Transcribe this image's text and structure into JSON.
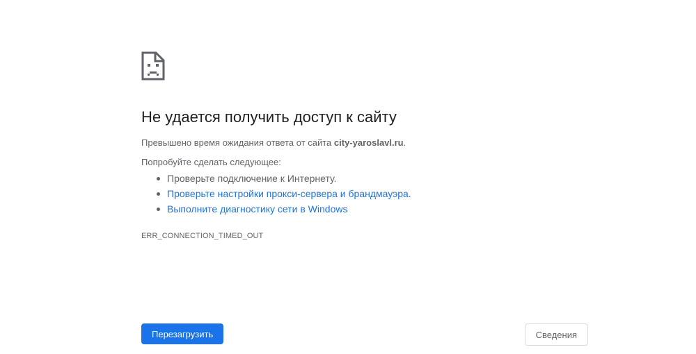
{
  "error": {
    "icon": "sad-page-icon",
    "title": "Не удается получить доступ к сайту",
    "summary_prefix": "Превышено время ожидания ответа от сайта ",
    "site": "city-yaroslavl.ru",
    "summary_suffix": ".",
    "suggestions_heading": "Попробуйте сделать следующее:",
    "suggestions": [
      {
        "text": "Проверьте подключение к Интернету."
      },
      {
        "text": "Проверьте настройки прокси-сервера и брандмауэра."
      },
      {
        "text": "Выполните диагностику сети в Windows"
      }
    ],
    "code": "ERR_CONNECTION_TIMED_OUT"
  },
  "buttons": {
    "reload_label": "Перезагрузить",
    "details_label": "Сведения"
  },
  "colors": {
    "accent": "#1a73e8",
    "text_primary": "#202124",
    "text_secondary": "#5f6368",
    "border": "#dadce0"
  }
}
